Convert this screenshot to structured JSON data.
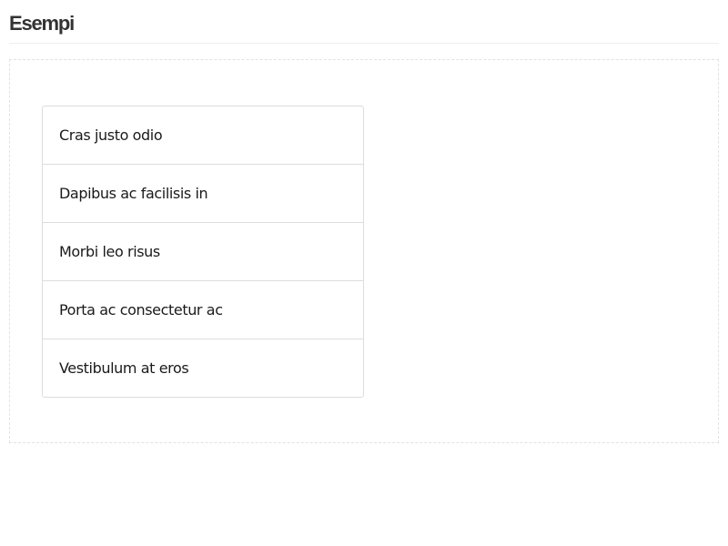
{
  "header": {
    "title": "Esempi"
  },
  "list_group": {
    "items": [
      {
        "label": "Cras justo odio"
      },
      {
        "label": "Dapibus ac facilisis in"
      },
      {
        "label": "Morbi leo risus"
      },
      {
        "label": "Porta ac consectetur ac"
      },
      {
        "label": "Vestibulum at eros"
      }
    ]
  },
  "colors": {
    "border": "#dddddd",
    "title_text": "#333333",
    "item_text": "#1a1a1a"
  }
}
